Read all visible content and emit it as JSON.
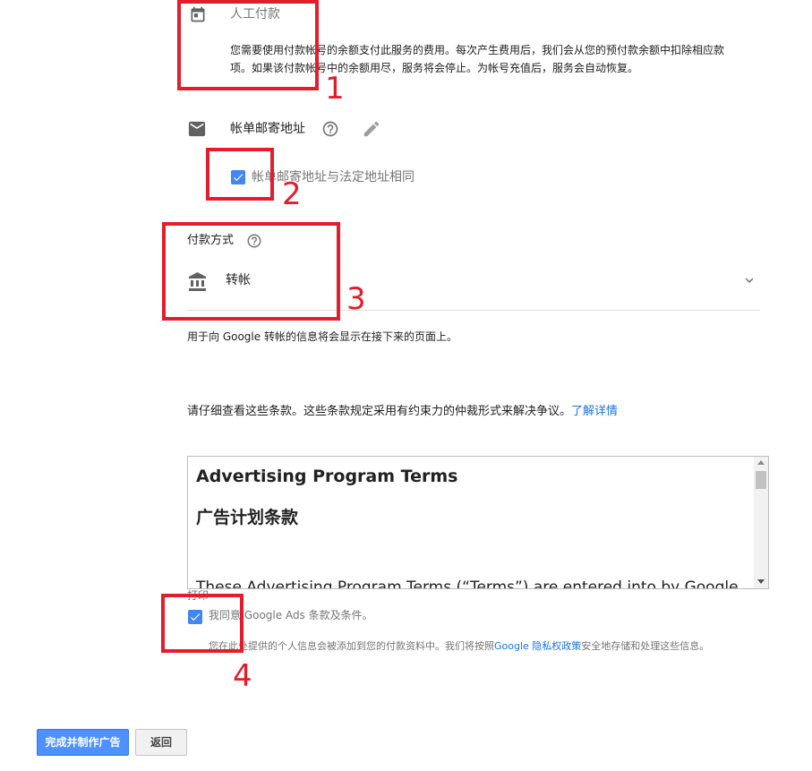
{
  "manual_payment": {
    "title": "人工付款",
    "description_line1": "您需要使用付款帐号的余额支付此服务的费用。每次产生费用后，我们会从您的预付款余额中扣除相应款",
    "description_line2": "项。如果该付款帐号中的余额用尽，服务将会停止。为帐号充值后，服务会自动恢复。"
  },
  "billing_address": {
    "label": "帐单邮寄地址",
    "checkbox_label": "帐单邮寄地址与法定地址相同",
    "checked": true
  },
  "payment_method": {
    "label": "付款方式",
    "selected": "转帐",
    "note": "用于向 Google 转帐的信息将会显示在接下来的页面上。"
  },
  "terms": {
    "intro": "请仔细查看这些条款。这些条款规定采用有约束力的仲裁形式来解决争议。",
    "learn_more": "了解详情",
    "heading_en": "Advertising Program Terms",
    "heading_zh": "广告计划条款",
    "body_start": "These Advertising Program Terms (“Terms”) are entered into by Google",
    "print_label": "打印"
  },
  "agree": {
    "checkbox_label": "我同意 Google Ads 条款及条件。",
    "checked": true,
    "privacy_prefix": "您在此处提供的个人信息会被添加到您的付款资料中。我们将按照",
    "privacy_link": "Google 隐私权政策",
    "privacy_suffix": "安全地存储和处理这些信息。"
  },
  "buttons": {
    "submit": "完成并制作广告",
    "back": "返回"
  },
  "annotations": [
    "1",
    "2",
    "3",
    "4"
  ],
  "colors": {
    "accent": "#4285f4",
    "link": "#1a73e8",
    "annotation": "#e31d2c"
  },
  "icons": [
    "calendar-icon",
    "mail-icon",
    "help-icon",
    "edit-icon",
    "bank-icon",
    "chevron-down-icon",
    "check-icon"
  ]
}
